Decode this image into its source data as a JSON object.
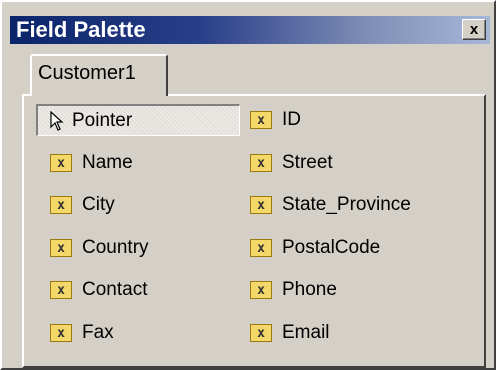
{
  "window": {
    "title": "Field Palette",
    "close_glyph": "x"
  },
  "tab": {
    "label": "Customer1"
  },
  "palette": {
    "pointer": {
      "label": "Pointer",
      "icon": "pointer-arrow-icon"
    },
    "field_icon_glyph": "x",
    "field_icon_color": "#f4d86a",
    "fields": [
      {
        "label": "ID",
        "icon": "field-icon"
      },
      {
        "label": "Name",
        "icon": "field-icon"
      },
      {
        "label": "Street",
        "icon": "field-icon"
      },
      {
        "label": "City",
        "icon": "field-icon"
      },
      {
        "label": "State_Province",
        "icon": "field-icon"
      },
      {
        "label": "Country",
        "icon": "field-icon"
      },
      {
        "label": "PostalCode",
        "icon": "field-icon"
      },
      {
        "label": "Contact",
        "icon": "field-icon"
      },
      {
        "label": "Phone",
        "icon": "field-icon"
      },
      {
        "label": "Fax",
        "icon": "field-icon"
      },
      {
        "label": "Email",
        "icon": "field-icon"
      }
    ]
  },
  "colors": {
    "title_bar_start": "#0a246a",
    "title_bar_end": "#a6b8d8",
    "face": "#d4d0c8"
  }
}
